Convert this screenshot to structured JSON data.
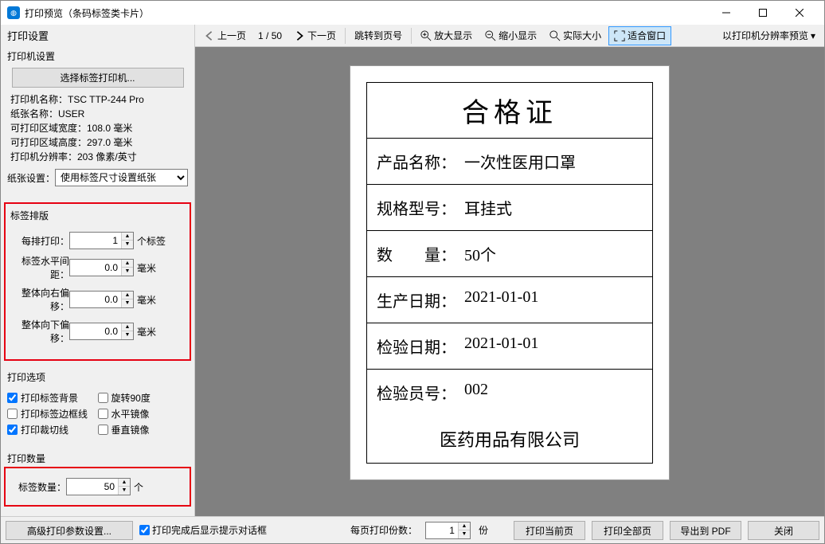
{
  "window": {
    "title": "打印预览（条码标签类卡片）"
  },
  "sidebar": {
    "header": "打印设置",
    "printer": {
      "group_title": "打印机设置",
      "select_btn": "选择标签打印机...",
      "lines": {
        "name": "打印机名称：TSC TTP-244 Pro",
        "paper": "纸张名称：USER",
        "width": "可打印区域宽度：108.0 毫米",
        "height": "可打印区域高度：297.0 毫米",
        "dpi": "打印机分辨率：203 像素/英寸"
      },
      "paper_setting_label": "纸张设置：",
      "paper_setting_value": "使用标签尺寸设置纸张"
    },
    "layout": {
      "group_title": "标签排版",
      "per_row_label": "每排打印：",
      "per_row_value": "1",
      "per_row_unit": "个标签",
      "hspace_label": "标签水平间距：",
      "hspace_value": "0.0",
      "hspace_unit": "毫米",
      "right_offset_label": "整体向右偏移：",
      "right_offset_value": "0.0",
      "right_offset_unit": "毫米",
      "down_offset_label": "整体向下偏移：",
      "down_offset_value": "0.0",
      "down_offset_unit": "毫米"
    },
    "options": {
      "group_title": "打印选项",
      "print_bg": "打印标签背景",
      "rotate90": "旋转90度",
      "print_border": "打印标签边框线",
      "hmirror": "水平镜像",
      "print_cut": "打印裁切线",
      "vmirror": "垂直镜像"
    },
    "qty": {
      "group_title": "打印数量",
      "label": "标签数量：",
      "value": "50",
      "unit": "个"
    }
  },
  "toolbar": {
    "prev": "上一页",
    "page": "1 / 50",
    "next": "下一页",
    "goto": "跳转到页号",
    "zoom_in": "放大显示",
    "zoom_out": "缩小显示",
    "actual": "实际大小",
    "fit": "适合窗口",
    "preview_mode": "以打印机分辨率预览"
  },
  "cert": {
    "title": "合格证",
    "rows": [
      {
        "k": "产品名称：",
        "v": "一次性医用口罩"
      },
      {
        "k": "规格型号：",
        "v": "耳挂式"
      },
      {
        "k": "数　　量：",
        "v": "50个"
      },
      {
        "k": "生产日期：",
        "v": "2021-01-01"
      },
      {
        "k": "检验日期：",
        "v": "2021-01-01"
      },
      {
        "k": "检验员号：",
        "v": "002"
      }
    ],
    "footer": "医药用品有限公司"
  },
  "footer": {
    "advanced": "高级打印参数设置...",
    "show_prompt": "打印完成后显示提示对话框",
    "copies_label": "每页打印份数：",
    "copies_value": "1",
    "copies_unit": "份",
    "print_current": "打印当前页",
    "print_all": "打印全部页",
    "export_pdf": "导出到 PDF",
    "close": "关闭"
  }
}
